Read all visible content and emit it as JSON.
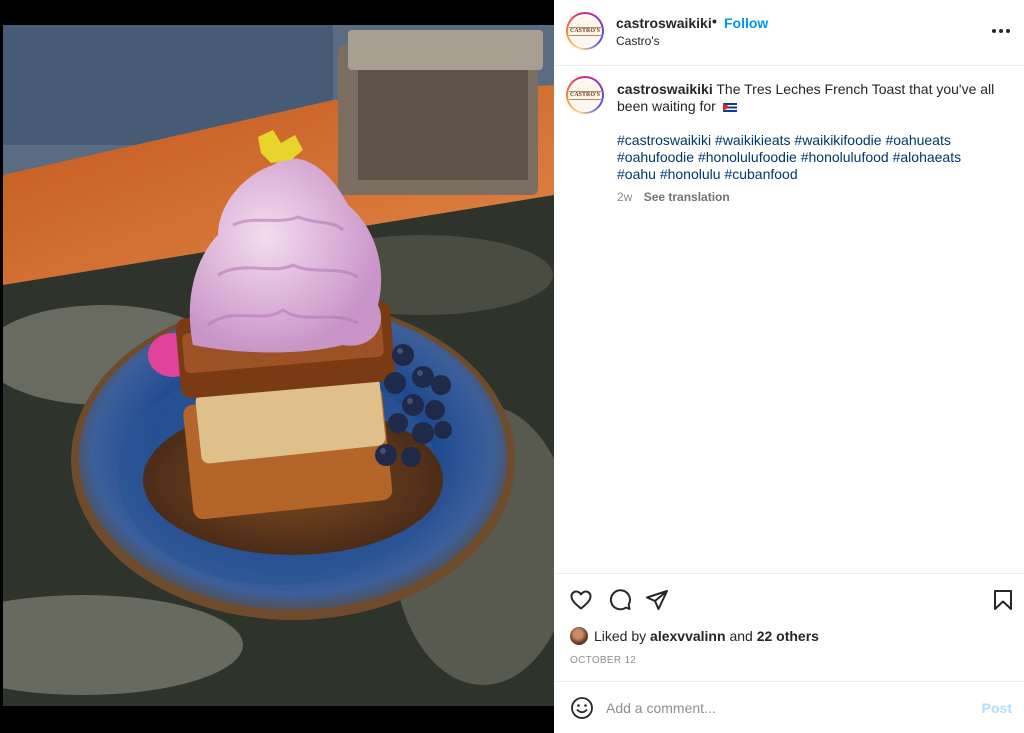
{
  "post": {
    "username": "castroswaikiki",
    "separator": "•",
    "follow_label": "Follow",
    "location": "Castro's",
    "avatar_text": "CASTRO'S",
    "caption_text": "The Tres Leches French Toast that you've all been waiting for",
    "hashtags": [
      "#castroswaikiki",
      "#waikikieats",
      "#waikikifoodie",
      "#oahueats",
      "#oahufoodie",
      "#honolulufoodie",
      "#honolulufood",
      "#alohaeats",
      "#oahu",
      "#honolulu",
      "#cubanfood"
    ],
    "time_ago": "2w",
    "see_translation": "See translation",
    "liked_prefix": "Liked by",
    "liked_user": "alexvvalinn",
    "liked_and": "and",
    "liked_others": "22 others",
    "date": "OCTOBER 12",
    "comment_placeholder": "Add a comment...",
    "post_label": "Post"
  },
  "icons": {
    "more": "more-options-icon",
    "like": "heart-icon",
    "comment": "comment-icon",
    "share": "share-icon",
    "save": "bookmark-icon",
    "emoji": "emoji-icon",
    "flag": "cuba-flag-icon"
  },
  "colors": {
    "link_blue": "#0095f6",
    "hashtag": "#00376b",
    "muted": "#8e8e8e",
    "post_disabled": "#b2dffc"
  }
}
